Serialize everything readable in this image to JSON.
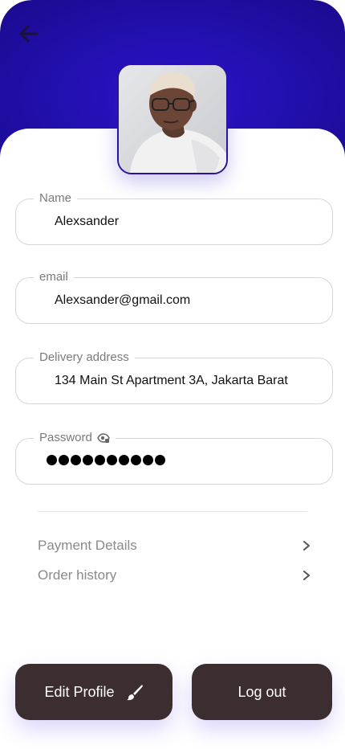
{
  "header": {
    "back_icon": "arrow-left-icon",
    "accent_color": "#2210b0"
  },
  "profile": {
    "avatar_icon": "profile-photo"
  },
  "fields": {
    "name": {
      "label": "Name",
      "value": "Alexsander"
    },
    "email": {
      "label": "email",
      "value": "Alexsander@gmail.com"
    },
    "address": {
      "label": "Delivery address",
      "value": "134 Main St Apartment 3A, Jakarta Barat"
    },
    "password": {
      "label": "Password",
      "dot_count": 10,
      "toggle_icon": "eye-lock-icon"
    }
  },
  "menu": {
    "payment": {
      "label": "Payment Details",
      "icon": "chevron-right-icon"
    },
    "orders": {
      "label": "Order history",
      "icon": "chevron-right-icon"
    }
  },
  "actions": {
    "edit_label": "Edit Profile",
    "edit_icon": "paintbrush-icon",
    "logout_label": "Log out",
    "button_color": "#3c2e30"
  }
}
